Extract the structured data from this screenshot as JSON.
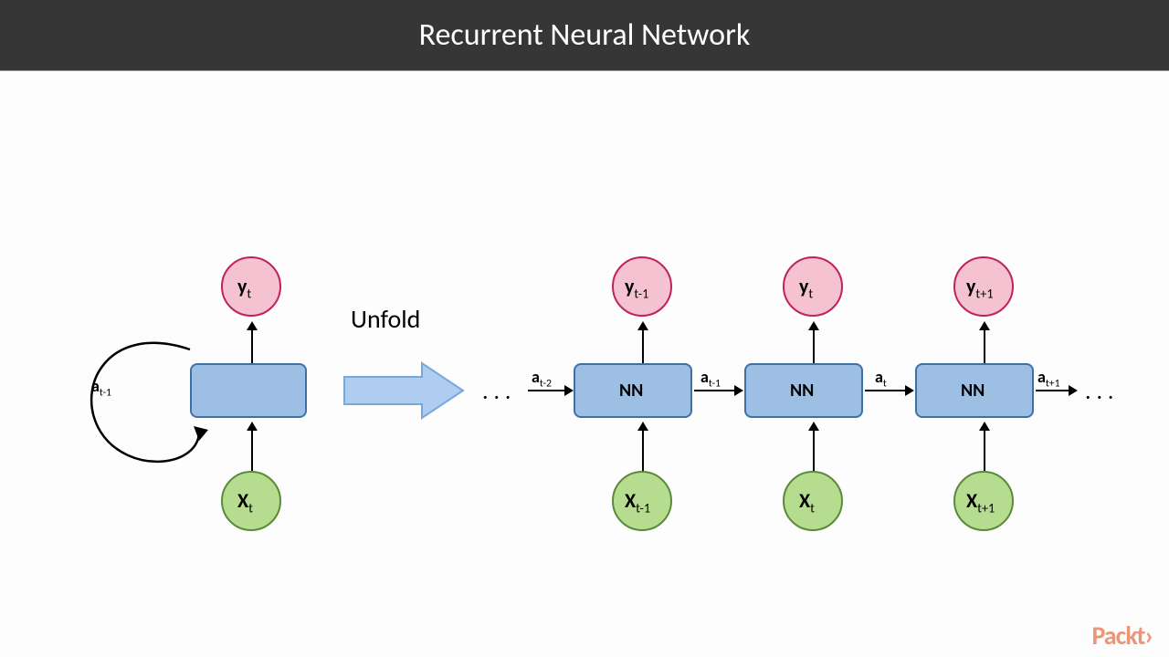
{
  "title": "Recurrent Neural Network",
  "unfold_label": "Unfold",
  "brand": "Packt›",
  "ellipsis": ". . .",
  "colors": {
    "y_fill": "#f5c2d1",
    "y_stroke": "#c0225a",
    "x_fill": "#b6dd8f",
    "x_stroke": "#5a8a3a",
    "box_fill": "#9dbfe4",
    "box_stroke": "#3f6fa5",
    "big_arrow_fill": "#aecdf1",
    "big_arrow_stroke": "#7ba7d7"
  },
  "folded": {
    "y_label": "y",
    "y_sub": "t",
    "x_label": "X",
    "x_sub": "t",
    "loop_label_a": "a",
    "loop_label_sub": "t-1",
    "box_label": ""
  },
  "hidden_arrows": [
    {
      "label_a": "a",
      "label_sub": "t-2"
    },
    {
      "label_a": "a",
      "label_sub": "t-1"
    },
    {
      "label_a": "a",
      "label_sub": "t"
    },
    {
      "label_a": "a",
      "label_sub": "t+1"
    }
  ],
  "unfolded": [
    {
      "y_label": "y",
      "y_sub": "t-1",
      "x_label": "X",
      "x_sub": "t-1",
      "box_label": "NN"
    },
    {
      "y_label": "y",
      "y_sub": "t",
      "x_label": "X",
      "x_sub": "t",
      "box_label": "NN"
    },
    {
      "y_label": "y",
      "y_sub": "t+1",
      "x_label": "X",
      "x_sub": "t+1",
      "box_label": "NN"
    }
  ]
}
